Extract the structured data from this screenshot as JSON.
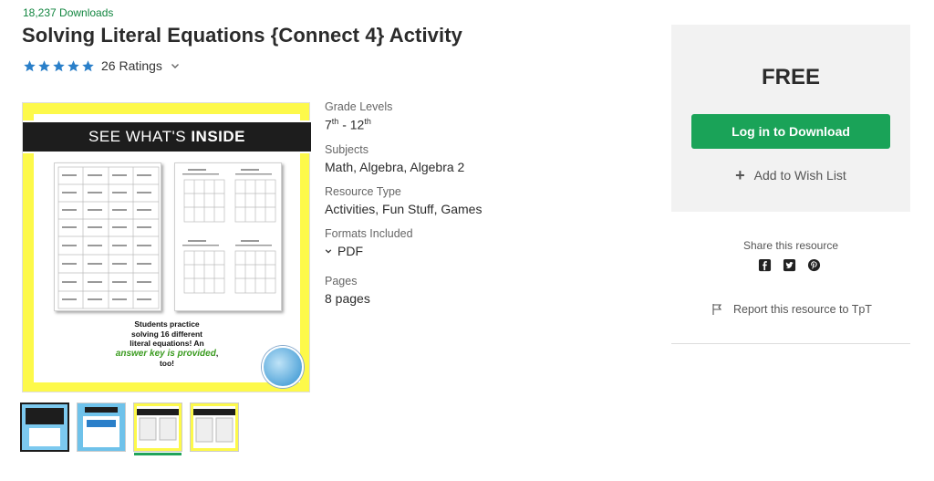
{
  "product": {
    "downloads": "18,237 Downloads",
    "title": "Solving Literal Equations {Connect 4} Activity",
    "rating": {
      "stars": 5,
      "label": "26 Ratings"
    }
  },
  "preview": {
    "banner": "SEE WHAT'S INSIDE",
    "banner_lead": "SEE WHAT'S ",
    "banner_bold": "INSIDE",
    "caption_line1": "Students practice",
    "caption_line2": "solving 16 different",
    "caption_line3": "literal equations! An",
    "caption_highlight": "answer key is provided",
    "caption_tail": ", too!"
  },
  "details": {
    "grade_label": "Grade Levels",
    "grade_from": "7",
    "grade_from_sup": "th",
    "grade_sep": " - ",
    "grade_to": "12",
    "grade_to_sup": "th",
    "subjects_label": "Subjects",
    "subjects_value": "Math, Algebra, Algebra 2",
    "resource_label": "Resource Type",
    "resource_value": "Activities, Fun Stuff, Games",
    "formats_label": "Formats Included",
    "formats_value": "PDF",
    "pages_label": "Pages",
    "pages_value": "8 pages"
  },
  "purchase": {
    "price": "FREE",
    "login_button": "Log in to Download",
    "wishlist": "Add to Wish List"
  },
  "share": {
    "label": "Share this resource",
    "icons": [
      "facebook-icon",
      "twitter-icon",
      "pinterest-icon"
    ],
    "report": "Report this resource to TpT"
  },
  "colors": {
    "accent_green": "#1aa358",
    "downloads_green": "#11853f",
    "star_blue": "#2a7fc9",
    "preview_yellow": "#fdf94a"
  }
}
